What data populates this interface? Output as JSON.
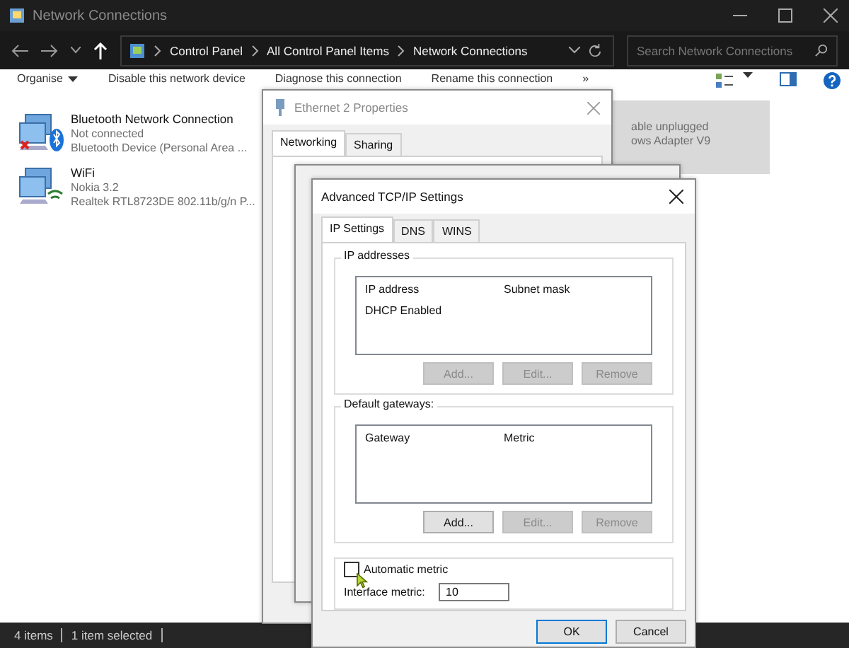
{
  "window": {
    "title": "Network Connections",
    "breadcrumb": [
      "Control Panel",
      "All Control Panel Items",
      "Network Connections"
    ],
    "search_placeholder": "Search Network Connections"
  },
  "commands": [
    "Organise",
    "Disable this network device",
    "Diagnose this connection",
    "Rename this connection",
    "»"
  ],
  "connections": [
    {
      "kind": "bluetooth",
      "name": "Bluetooth Network Connection",
      "status": "Not connected",
      "device": "Bluetooth Device (Personal Area ...",
      "selected": false
    },
    {
      "kind": "wifi",
      "name": "WiFi",
      "status": "Nokia 3.2",
      "device": "Realtek RTL8723DE 802.11b/g/n P...",
      "selected": false
    },
    {
      "kind": "ethernet",
      "status": "able unplugged",
      "device": "ows Adapter V9",
      "selected": true
    }
  ],
  "status_bar": {
    "count": "4 items",
    "selection": "1 item selected"
  },
  "properties_dialog": {
    "title": "Ethernet 2 Properties",
    "tabs": [
      {
        "label": "Networking",
        "selected": true
      },
      {
        "label": "Sharing",
        "selected": false
      }
    ]
  },
  "advanced_dialog": {
    "title": "Advanced TCP/IP Settings",
    "tabs": [
      {
        "label": "IP Settings",
        "selected": true
      },
      {
        "label": "DNS",
        "selected": false
      },
      {
        "label": "WINS",
        "selected": false
      }
    ],
    "groups": [
      {
        "title": "IP addresses",
        "columns": [
          "IP address",
          "Subnet mask"
        ],
        "rows": [
          [
            "DHCP Enabled"
          ]
        ],
        "buttons": [
          {
            "label": "Add...",
            "disabled": true
          },
          {
            "label": "Edit...",
            "disabled": true
          },
          {
            "label": "Remove",
            "disabled": true
          }
        ]
      },
      {
        "title": "Default gateways:",
        "columns": [
          "Gateway",
          "Metric"
        ],
        "buttons": [
          {
            "label": "Add...",
            "disabled": false
          },
          {
            "label": "Edit...",
            "disabled": true
          },
          {
            "label": "Remove",
            "disabled": true
          }
        ]
      }
    ],
    "automatic_metric": {
      "label": "Automatic metric",
      "checked": false
    },
    "interface_metric": {
      "label": "Interface metric:",
      "value": "10"
    },
    "buttons": [
      {
        "label": "OK",
        "default": true
      },
      {
        "label": "Cancel",
        "default": false
      }
    ]
  }
}
